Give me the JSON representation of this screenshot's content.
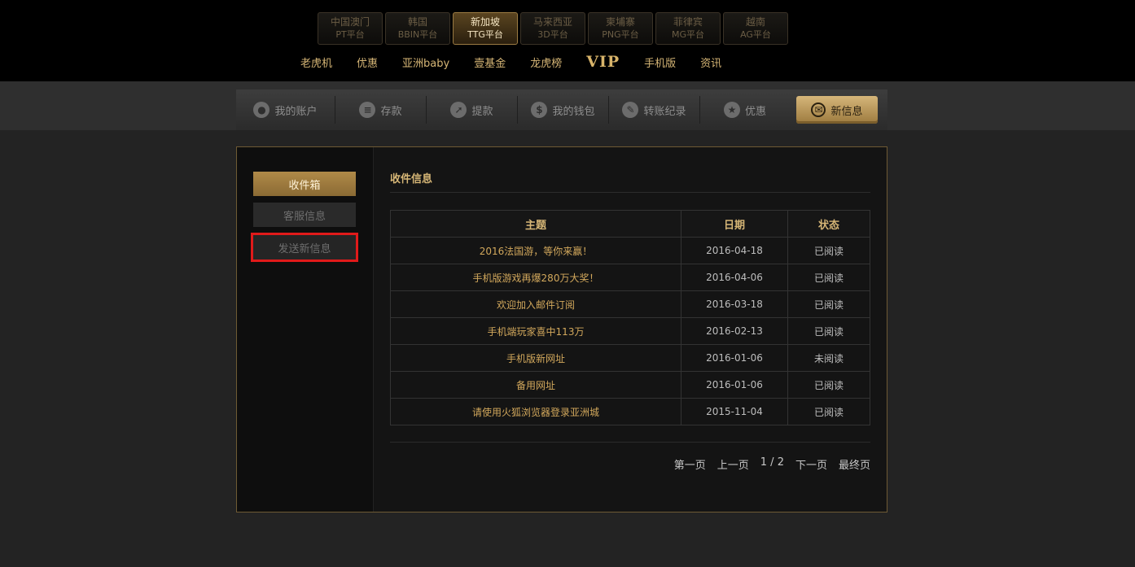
{
  "platforms": [
    {
      "name": "中国澳门",
      "sub": "PT平台"
    },
    {
      "name": "韩国",
      "sub": "BBIN平台"
    },
    {
      "name": "新加坡",
      "sub": "TTG平台"
    },
    {
      "name": "马来西亚",
      "sub": "3D平台"
    },
    {
      "name": "柬埔寨",
      "sub": "PNG平台"
    },
    {
      "name": "菲律宾",
      "sub": "MG平台"
    },
    {
      "name": "越南",
      "sub": "AG平台"
    }
  ],
  "topnav": [
    "老虎机",
    "优惠",
    "亚洲baby",
    "壹基金",
    "龙虎榜",
    "VIP",
    "手机版",
    "资讯"
  ],
  "account_menu": [
    "我的账户",
    "存款",
    "提款",
    "我的钱包",
    "转账纪录",
    "优惠",
    "新信息"
  ],
  "sidebar": {
    "inbox": "收件箱",
    "service": "客服信息",
    "send": "发送新信息"
  },
  "content": {
    "title": "收件信息",
    "headers": {
      "subject": "主题",
      "date": "日期",
      "status": "状态"
    },
    "rows": [
      {
        "subject": "2016法国游，等你来赢！",
        "date": "2016-04-18",
        "status": "已阅读"
      },
      {
        "subject": "手机版游戏再爆280万大奖！",
        "date": "2016-04-06",
        "status": "已阅读"
      },
      {
        "subject": "欢迎加入邮件订阅",
        "date": "2016-03-18",
        "status": "已阅读"
      },
      {
        "subject": "手机端玩家喜中113万",
        "date": "2016-02-13",
        "status": "已阅读"
      },
      {
        "subject": "手机版新网址",
        "date": "2016-01-06",
        "status": "未阅读"
      },
      {
        "subject": "备用网址",
        "date": "2016-01-06",
        "status": "已阅读"
      },
      {
        "subject": "请使用火狐浏览器登录亚洲城",
        "date": "2015-11-04",
        "status": "已阅读"
      }
    ]
  },
  "pager": {
    "first": "第一页",
    "prev": "上一页",
    "page": "1 / 2",
    "next": "下一页",
    "last": "最终页"
  },
  "colors": {
    "accent": "#d6b676",
    "highlight": "#e01a1a",
    "background": "#232323"
  }
}
